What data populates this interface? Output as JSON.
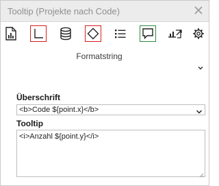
{
  "window": {
    "title": "Tooltip (Projekte nach Code)"
  },
  "toolbar": {
    "buttons": [
      {
        "icon": "document-chart-icon",
        "selected": false
      },
      {
        "icon": "axis-icon",
        "selected": true,
        "selection_color": "#d81d1d"
      },
      {
        "icon": "database-icon",
        "selected": false
      },
      {
        "icon": "diamond-marker-icon",
        "selected": true,
        "selection_color": "#d81d1d"
      },
      {
        "icon": "list-icon",
        "selected": false
      },
      {
        "icon": "speech-bubble-icon",
        "selected": true,
        "selection_color": "#2b8a3e"
      },
      {
        "icon": "chart-export-icon",
        "selected": false
      },
      {
        "icon": "gear-icon",
        "selected": false
      }
    ]
  },
  "format_section": {
    "label": "Formatstring"
  },
  "heading_field": {
    "label": "Überschrift",
    "value": "<b>Code ${point.x}</b>"
  },
  "tooltip_field": {
    "label": "Tooltip",
    "value": "<i>Anzahl ${point.y}</i>"
  },
  "colors": {
    "title_text": "#8f8f8f",
    "titlebar_bg": "#ececec",
    "selection_red": "#d81d1d",
    "selection_green": "#2b8a3e"
  }
}
